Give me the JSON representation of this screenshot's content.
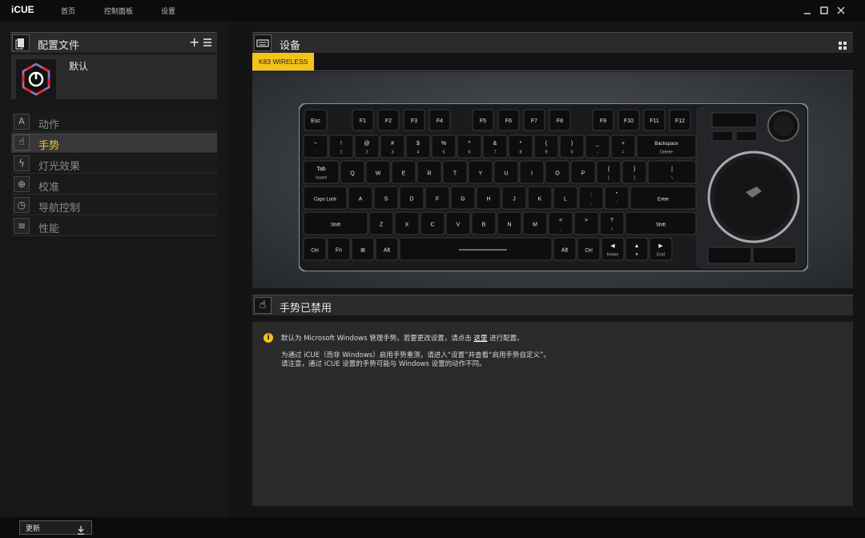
{
  "app": {
    "title": "iCUE"
  },
  "nav": {
    "home": "首页",
    "dashboard": "控制面板",
    "settings": "设置"
  },
  "profiles": {
    "title": "配置文件",
    "name": "默认"
  },
  "menu": [
    {
      "label": "动作",
      "icon": "A"
    },
    {
      "label": "手势",
      "icon": "☝"
    },
    {
      "label": "灯光效果",
      "icon": "ϟ"
    },
    {
      "label": "校准",
      "icon": "⊕"
    },
    {
      "label": "导航控制",
      "icon": "◷"
    },
    {
      "label": "性能",
      "icon": "≡"
    }
  ],
  "device": {
    "title": "设备",
    "tab": "K83 WIRELESS"
  },
  "gesture": {
    "title": "手势已禁用"
  },
  "info": {
    "line1_pre": "默认为 Microsoft Windows 管理手势。若要更改设置，请点击",
    "line1_link": "这里",
    "line1_post": "进行配置。",
    "line2": "为通过 iCUE（而非 Windows）启用手势重测，请进入“设置”并查看“启用手势自定义”。",
    "line3": "请注意，通过 iCUE 设置的手势可能与 Windows 设置的动作不同。"
  },
  "footer": {
    "update": "更新"
  },
  "keyboard": {
    "fn_row": [
      "Esc",
      "F1",
      "F2",
      "F3",
      "F4",
      "F5",
      "F6",
      "F7",
      "F8",
      "F9",
      "F10",
      "F11",
      "F12"
    ],
    "row1": [
      "~",
      "!",
      "@",
      "#",
      "$",
      "%",
      "^",
      "&",
      "*",
      "(",
      ")",
      "_",
      "+",
      "Backspace"
    ],
    "row1_sub": [
      "`",
      "1",
      "2",
      "3",
      "4",
      "5",
      "6",
      "7",
      "8",
      "9",
      "0",
      "-",
      "=",
      "Delete"
    ],
    "row2": [
      "Tab",
      "Q",
      "W",
      "E",
      "R",
      "T",
      "Y",
      "U",
      "I",
      "O",
      "P",
      "{",
      "}",
      "|"
    ],
    "row2_sub": [
      "Insert",
      "",
      "",
      "",
      "",
      "",
      "",
      "",
      "",
      "",
      "",
      "[",
      "]",
      "\\"
    ],
    "row3": [
      "Caps Lock",
      "A",
      "S",
      "D",
      "F",
      "G",
      "H",
      "J",
      "K",
      "L",
      ":",
      "\"",
      "Enter"
    ],
    "row3_sub": [
      "",
      "",
      "",
      "",
      "",
      "",
      "",
      "",
      "",
      "",
      ";",
      "'",
      ""
    ],
    "row4": [
      "Shift",
      "Z",
      "X",
      "C",
      "V",
      "B",
      "N",
      "M",
      "<",
      ">",
      "?",
      "Shift"
    ],
    "row4_sub": [
      "",
      "",
      "",
      "",
      "",
      "",
      "",
      "",
      ",",
      ".",
      "/",
      ""
    ],
    "row5": [
      "Ctrl",
      "Fn",
      "⊞",
      "Alt",
      "",
      "Alt",
      "Ctrl",
      "◀",
      "▲",
      "▶"
    ],
    "row5_sub": [
      "",
      "",
      "",
      "",
      "",
      "",
      "",
      "Home",
      "▼",
      "End"
    ]
  },
  "colors": {
    "accent": "#f3c317",
    "panel": "#2b2b2b",
    "bg": "#141414"
  }
}
